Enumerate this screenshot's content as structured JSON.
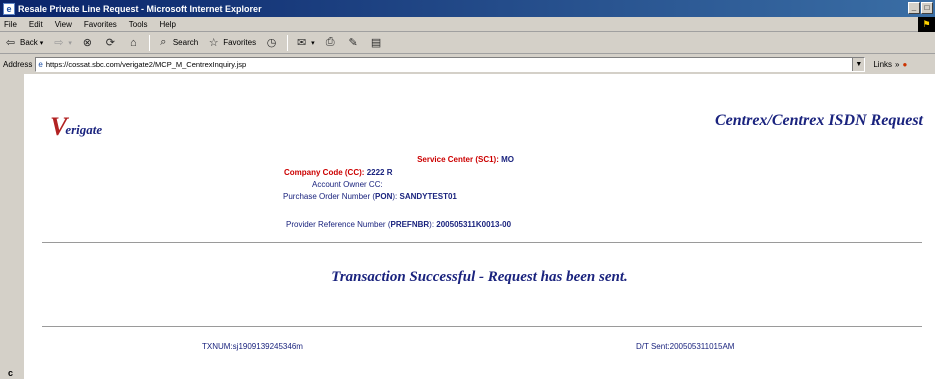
{
  "window": {
    "title": "Resale Private Line Request - Microsoft Internet Explorer"
  },
  "menu": {
    "items": [
      "File",
      "Edit",
      "View",
      "Favorites",
      "Tools",
      "Help"
    ]
  },
  "toolbar": {
    "back_label": "Back",
    "search_label": "Search",
    "favorites_label": "Favorites"
  },
  "address": {
    "label": "Address",
    "url": "https://cossat.sbc.com/verigate2/MCP_M_CentrexInquiry.jsp",
    "links_label": "Links"
  },
  "page": {
    "logo_v": "V",
    "logo_text": "erigate",
    "heading": "Centrex/Centrex ISDN Request",
    "sc1_label": "Service Center (SC1):",
    "sc1_value": "MO",
    "cc_label": "Company Code (CC):",
    "cc_value": "2222 R",
    "acct_owner_label": "Account Owner CC:",
    "acct_owner_value": "",
    "pon_label_pre": "Purchase Order Number (",
    "pon_label_bold": "PON",
    "pon_label_post": "):",
    "pon_value": "SANDYTEST01",
    "prefnbr_label_pre": "Provider Reference Number (",
    "prefnbr_label_bold": "PREFNBR",
    "prefnbr_label_post": "):",
    "prefnbr_value": "200505311K0013-00",
    "success_message": "Transaction Successful - Request has been sent.",
    "txnum": "TXNUM:sj1909139245346m",
    "dt_sent": "D/T Sent:200505311015AM"
  },
  "left_strip_letter": "c",
  "colors": {
    "heading": "#1a237e",
    "label_red": "#cc0000",
    "title_bar": "#0a246a"
  }
}
